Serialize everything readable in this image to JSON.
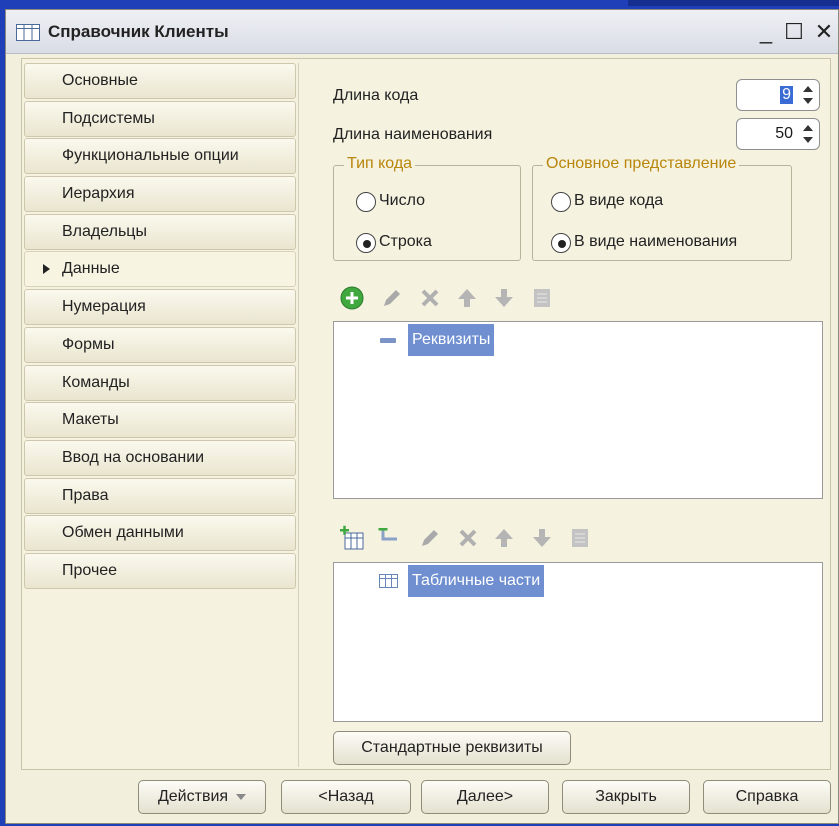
{
  "window": {
    "title": "Справочник Клиенты",
    "controls": {
      "minimize": "_",
      "maximize": "☐",
      "close": "✕"
    }
  },
  "sidebar": {
    "items": [
      {
        "label": "Основные"
      },
      {
        "label": "Подсистемы"
      },
      {
        "label": "Функциональные опции"
      },
      {
        "label": "Иерархия"
      },
      {
        "label": "Владельцы"
      },
      {
        "label": "Данные",
        "active": true
      },
      {
        "label": "Нумерация"
      },
      {
        "label": "Формы"
      },
      {
        "label": "Команды"
      },
      {
        "label": "Макеты"
      },
      {
        "label": "Ввод на основании"
      },
      {
        "label": "Права"
      },
      {
        "label": "Обмен данными"
      },
      {
        "label": "Прочее"
      }
    ]
  },
  "main": {
    "code_length": {
      "label": "Длина кода",
      "value": "9"
    },
    "name_length": {
      "label": "Длина наименования",
      "value": "50"
    },
    "code_type": {
      "title": "Тип кода",
      "options": [
        "Число",
        "Строка"
      ],
      "selected": "Строка"
    },
    "main_representation": {
      "title": "Основное представление",
      "options": [
        "В виде кода",
        "В виде наименования"
      ],
      "selected": "В виде наименования"
    },
    "attributes_tree": {
      "root": "Реквизиты"
    },
    "tabular_tree": {
      "root": "Табличные части"
    },
    "standard_attributes_button": "Стандартные реквизиты"
  },
  "footer": {
    "actions": "Действия",
    "back": "<Назад",
    "next": "Далее>",
    "close": "Закрыть",
    "help": "Справка"
  },
  "icons": {
    "add": "plus-circle-icon",
    "edit": "pencil-icon",
    "delete": "delete-x-icon",
    "up": "arrow-up-icon",
    "down": "arrow-down-icon",
    "sort": "list-sort-icon"
  }
}
